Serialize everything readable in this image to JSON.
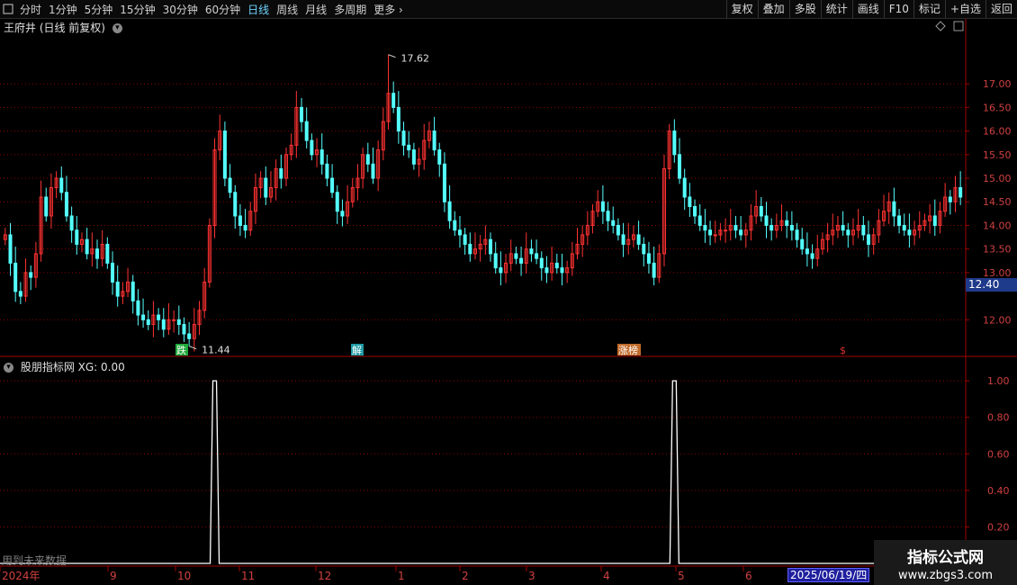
{
  "toolbar": {
    "periods": [
      {
        "label": "分时",
        "active": false
      },
      {
        "label": "1分钟",
        "active": false
      },
      {
        "label": "5分钟",
        "active": false
      },
      {
        "label": "15分钟",
        "active": false
      },
      {
        "label": "30分钟",
        "active": false
      },
      {
        "label": "60分钟",
        "active": false
      },
      {
        "label": "日线",
        "active": true
      },
      {
        "label": "周线",
        "active": false
      },
      {
        "label": "月线",
        "active": false
      },
      {
        "label": "多周期",
        "active": false
      },
      {
        "label": "更多",
        "active": false
      }
    ],
    "actions": [
      "复权",
      "叠加",
      "多股",
      "统计",
      "画线",
      "F10",
      "标记",
      "+自选",
      "返回"
    ]
  },
  "main_title": "王府井 (日线 前复权)",
  "indicator_title": "股朋指标网 XG: 0.00",
  "price_axis": [
    "17.00",
    "16.50",
    "16.00",
    "15.50",
    "15.00",
    "14.50",
    "14.00",
    "13.50",
    "13.00",
    "12.00"
  ],
  "indicator_axis": [
    "1.00",
    "0.80",
    "0.60",
    "0.40",
    "0.20"
  ],
  "current_price": "12.40",
  "high_label": "17.62",
  "low_label": "11.44",
  "signals": [
    {
      "text": "跌",
      "color": "#1faa3a"
    },
    {
      "text": "解",
      "color": "#1e9aa5"
    },
    {
      "text": "涨榜",
      "color": "#c06a2a"
    },
    {
      "text": "$",
      "color": "#e03030"
    }
  ],
  "date_axis": [
    "2024年",
    "9",
    "10",
    "11",
    "12",
    "1",
    "2",
    "3",
    "4",
    "5",
    "6"
  ],
  "cursor_date": "2025/06/19/四",
  "future_note": "用到未来数据",
  "watermark": {
    "title": "指标公式网",
    "url": "www.zbgs3.com"
  },
  "colors": {
    "up": "#ff3232",
    "down": "#54ffff",
    "grid": "#8b0000",
    "axis": "#a00000",
    "indicator": "#ffffff"
  },
  "chart_data": {
    "type": "candlestick",
    "price_range": [
      11.3,
      17.9
    ],
    "high": 17.62,
    "low": 11.44,
    "closes": [
      13.8,
      13.2,
      12.6,
      12.5,
      13.0,
      12.9,
      13.4,
      14.6,
      14.2,
      14.8,
      15.0,
      14.7,
      14.2,
      13.9,
      13.6,
      13.7,
      13.4,
      13.5,
      13.3,
      13.6,
      13.2,
      12.8,
      12.5,
      12.6,
      12.8,
      12.4,
      12.1,
      12.0,
      11.9,
      12.1,
      12.0,
      11.8,
      12.0,
      12.0,
      11.9,
      11.7,
      11.6,
      11.9,
      12.2,
      12.8,
      14.0,
      15.6,
      16.0,
      15.0,
      14.7,
      14.2,
      14.0,
      13.9,
      14.3,
      14.8,
      15.0,
      14.6,
      14.8,
      15.2,
      15.0,
      15.5,
      15.7,
      16.5,
      16.2,
      15.8,
      15.5,
      15.6,
      15.3,
      15.0,
      14.7,
      14.3,
      14.2,
      14.5,
      14.8,
      15.0,
      15.5,
      15.3,
      15.0,
      15.6,
      16.2,
      16.8,
      16.5,
      16.0,
      15.7,
      15.6,
      15.3,
      15.4,
      15.8,
      16.0,
      15.6,
      15.3,
      14.5,
      14.1,
      13.9,
      13.8,
      13.6,
      13.4,
      13.5,
      13.6,
      13.7,
      13.4,
      13.1,
      13.0,
      13.2,
      13.4,
      13.3,
      13.2,
      13.5,
      13.4,
      13.3,
      13.1,
      13.0,
      13.2,
      13.1,
      13.0,
      13.1,
      13.4,
      13.6,
      13.8,
      14.0,
      14.3,
      14.5,
      14.3,
      14.1,
      14.0,
      13.8,
      13.6,
      13.7,
      13.8,
      13.6,
      13.4,
      13.2,
      12.9,
      13.4,
      15.2,
      16.0,
      15.5,
      15.0,
      14.6,
      14.4,
      14.2,
      14.0,
      13.9,
      13.8,
      13.8,
      13.9,
      13.9,
      14.0,
      13.9,
      13.8,
      13.9,
      14.2,
      14.4,
      14.2,
      14.0,
      13.9,
      14.0,
      14.1,
      14.0,
      13.9,
      13.7,
      13.5,
      13.4,
      13.3,
      13.5,
      13.7,
      13.8,
      13.9,
      14.0,
      13.9,
      13.8,
      13.9,
      14.0,
      13.8,
      13.6,
      13.8,
      14.1,
      14.3,
      14.5,
      14.2,
      14.0,
      13.9,
      13.8,
      13.9,
      14.0,
      14.1,
      14.2,
      14.0,
      14.3,
      14.6,
      14.5,
      14.8,
      14.6
    ],
    "indicator_spikes": [
      {
        "bar_index": 41,
        "value": 1.0
      },
      {
        "bar_index": 131,
        "value": 1.0
      }
    ],
    "indicator_range": [
      0,
      1.05
    ]
  }
}
